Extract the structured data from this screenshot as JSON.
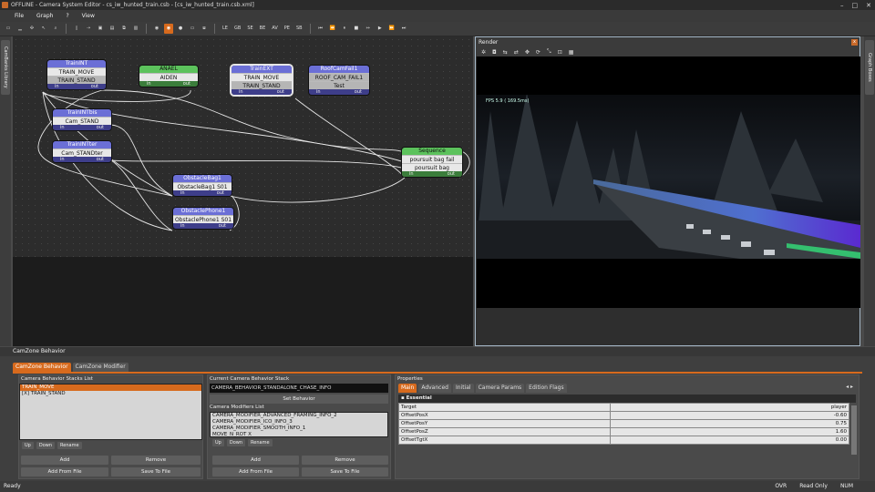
{
  "window": {
    "title": "OFFLINE - Camera System Editor - cs_iw_hunted_train.csb - [cs_iw_hunted_train.csb.xml]"
  },
  "menu": [
    "File",
    "Graph",
    "?",
    "View"
  ],
  "toolbar": [
    "LE",
    "GB",
    "SE",
    "BE",
    "AV",
    "PE",
    "SB"
  ],
  "left_dock": {
    "tab": "CamBanks Library"
  },
  "right_dock": {
    "tab": "Graph Boxes"
  },
  "graph": {
    "nodes": [
      {
        "id": "traininit",
        "title": "TrainINT",
        "rows": [
          "TRAIN_MOVE",
          "TRAIN_STAND"
        ],
        "in": "in",
        "out": "out",
        "color": "blue"
      },
      {
        "id": "anael",
        "title": "ANAEL",
        "rows": [
          "AIDEN"
        ],
        "in": "in",
        "out": "out",
        "color": "green"
      },
      {
        "id": "trainext",
        "title": "TrainEXT",
        "rows": [
          "TRAIN_MOVE",
          "TRAIN_STAND"
        ],
        "in": "in",
        "out": "out",
        "color": "blue"
      },
      {
        "id": "roofcam",
        "title": "RoofCamFail1",
        "rows": [
          "ROOF_CAM_FAIL1",
          "Test"
        ],
        "in": "in",
        "out": "out",
        "color": "blue"
      },
      {
        "id": "trainbis",
        "title": "TrainINTbis",
        "rows": [
          "Cam_STAND"
        ],
        "in": "in",
        "out": "out",
        "color": "blue"
      },
      {
        "id": "trainter",
        "title": "TrainINTter",
        "rows": [
          "Cam_STANDter"
        ],
        "in": "in",
        "out": "out",
        "color": "blue"
      },
      {
        "id": "sequence",
        "title": "Sequence",
        "rows": [
          "poursuit bag fail",
          "poursuit bag"
        ],
        "in": "in",
        "out": "out",
        "color": "green"
      },
      {
        "id": "obstaclebag",
        "title": "ObstacleBag1",
        "rows": [
          "ObstacleBag1 S01"
        ],
        "in": "in",
        "out": "out",
        "color": "blue"
      },
      {
        "id": "obstaclephone",
        "title": "ObstaclePhone1",
        "rows": [
          "ObstaclePhone1 S01"
        ],
        "in": "in",
        "out": "out",
        "color": "blue"
      }
    ]
  },
  "render": {
    "title": "Render",
    "fps": "FPS  5.9 ( 169.5ms)",
    "close": "x"
  },
  "bottom": {
    "panel_title": "CamZone Behavior",
    "tabs": [
      "CamZone Behavior",
      "CamZone Modifier"
    ],
    "stacks": {
      "title": "Camera Behavior Stacks List",
      "items": [
        "TRAIN_MOVE",
        "[X] TRAIN_STAND"
      ],
      "small_buttons": [
        "Up",
        "Down",
        "Rename"
      ],
      "buttons": [
        "Add",
        "Remove",
        "Add From File",
        "Save To File"
      ]
    },
    "current": {
      "title": "Current Camera Behavior Stack",
      "value": "CAMERA_BEHAVIOR_STANDALONE_CHASE_INFO",
      "set_button": "Set Behavior",
      "modifiers_title": "Camera Modifiers List",
      "modifiers": [
        "CAMERA_MODIFIER_ADVANCED_FRAMING_INFO_2",
        "CAMERA_MODIFIER_ICO_INFO_3",
        "CAMERA_MODIFIER_SMOOTH_INFO_1",
        "MOVE_N_ROT X"
      ],
      "small_buttons": [
        "Up",
        "Down",
        "Rename"
      ],
      "buttons": [
        "Add",
        "Remove",
        "Add From File",
        "Save To File"
      ]
    },
    "properties": {
      "title": "Properties",
      "tabs": [
        "Main",
        "Advanced",
        "Initial",
        "Camera Params",
        "Edition Flags"
      ],
      "section": "Essential",
      "rows": [
        {
          "k": "Target",
          "v": "player"
        },
        {
          "k": "OffsetPosX",
          "v": "-0.60"
        },
        {
          "k": "OffsetPosY",
          "v": "0.75"
        },
        {
          "k": "OffsetPosZ",
          "v": "1.60"
        },
        {
          "k": "OffsetTgtX",
          "v": "0.00"
        }
      ]
    }
  },
  "status": {
    "left": "Ready",
    "ovr": "OVR",
    "ro": "Read Only",
    "num": "NUM"
  }
}
